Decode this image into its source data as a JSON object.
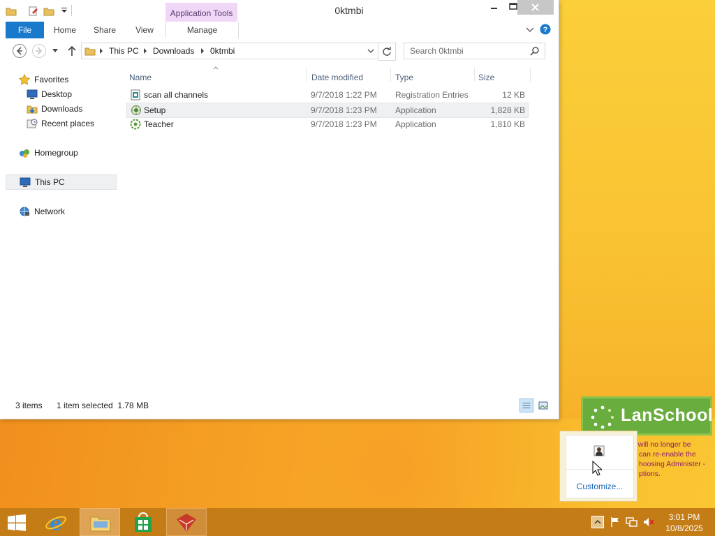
{
  "window": {
    "title": "0ktmbi",
    "context_tab_header": "Application Tools"
  },
  "ribbon": {
    "tabs": [
      "File",
      "Home",
      "Share",
      "View",
      "Manage"
    ]
  },
  "address": {
    "crumbs": [
      "This PC",
      "Downloads",
      "0ktmbi"
    ],
    "search_placeholder": "Search 0ktmbi"
  },
  "nav": {
    "favorites": "Favorites",
    "desktop": "Desktop",
    "downloads": "Downloads",
    "recent": "Recent places",
    "homegroup": "Homegroup",
    "thispc": "This PC",
    "network": "Network"
  },
  "columns": [
    "Name",
    "Date modified",
    "Type",
    "Size"
  ],
  "files": [
    {
      "name": "scan all channels",
      "date": "9/7/2018 1:22 PM",
      "type": "Registration Entries",
      "size": "12 KB"
    },
    {
      "name": "Setup",
      "date": "9/7/2018 1:23 PM",
      "type": "Application",
      "size": "1,828 KB"
    },
    {
      "name": "Teacher",
      "date": "9/7/2018 1:23 PM",
      "type": "Application",
      "size": "1,810 KB"
    }
  ],
  "status": {
    "count": "3 items",
    "selection": "1 item selected  1.78 MB"
  },
  "lanschool": {
    "title": "LanSchool",
    "msg1": "n will no longer be",
    "msg2": "can re-enable the",
    "msg3": "hoosing Administer -",
    "msg4": "ptions."
  },
  "tray": {
    "customize": "Customize...",
    "time": "3:01 PM",
    "date": "10/8/2025"
  },
  "colors": {
    "accent": "#1979ca",
    "taskbar": "#c47c16",
    "lanschool_green": "#69ad3e"
  }
}
